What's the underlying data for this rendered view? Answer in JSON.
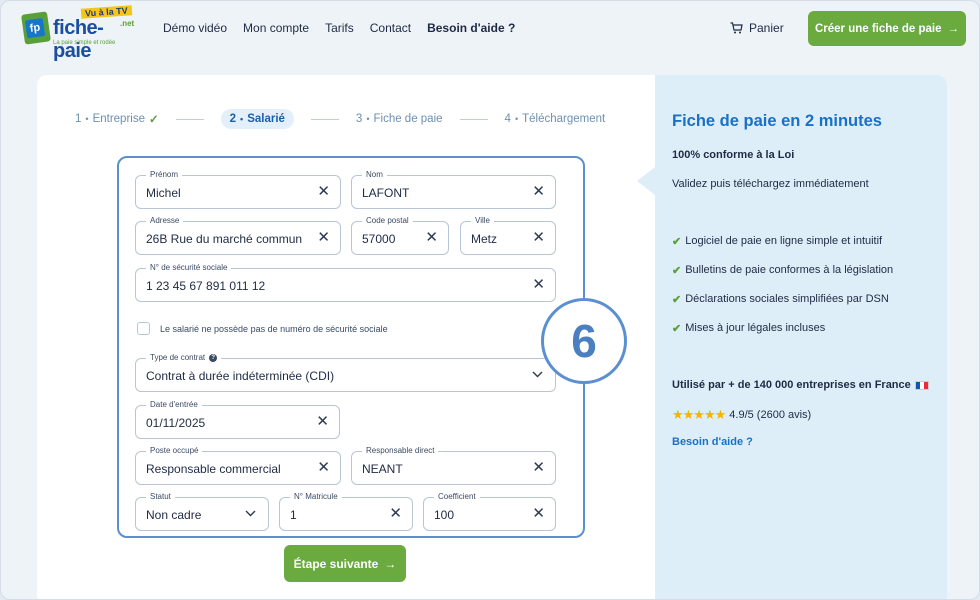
{
  "header": {
    "logo": {
      "name": "fiche-paie",
      "tv_badge": "Vu à la TV",
      "net": ".net",
      "tagline": "La paie simple et rodée"
    },
    "nav": [
      "Démo vidéo",
      "Mon compte",
      "Tarifs",
      "Contact",
      "Besoin d'aide ?"
    ],
    "cart_label": "Panier",
    "cta_label": "Créer une fiche de paie",
    "colors": {
      "accent_green": "#6aaa3e",
      "brand_blue": "#1a70c4"
    }
  },
  "steps": [
    {
      "num": "1",
      "label": "Entreprise",
      "status": "done"
    },
    {
      "num": "2",
      "label": "Salarié",
      "status": "active"
    },
    {
      "num": "3",
      "label": "Fiche de paie",
      "status": "todo"
    },
    {
      "num": "4",
      "label": "Téléchargement",
      "status": "todo"
    }
  ],
  "form": {
    "prenom": {
      "label": "Prénom",
      "value": "Michel"
    },
    "nom": {
      "label": "Nom",
      "value": "LAFONT"
    },
    "adresse": {
      "label": "Adresse",
      "value": "26B Rue du marché commun"
    },
    "code_postal": {
      "label": "Code postal",
      "value": "57000"
    },
    "ville": {
      "label": "Ville",
      "value": "Metz"
    },
    "secu": {
      "label": "N° de sécurité sociale",
      "value": "1 23 45 67 891 011 12"
    },
    "no_secu_checkbox": "Le salarié ne possède pas de numéro de sécurité sociale",
    "contrat": {
      "label": "Type de contrat",
      "value": "Contrat à durée indéterminée (CDI)"
    },
    "date_entree": {
      "label": "Date d'entrée",
      "value": "01/11/2025"
    },
    "poste": {
      "label": "Poste occupé",
      "value": "Responsable commercial"
    },
    "responsable": {
      "label": "Responsable direct",
      "value": "NEANT"
    },
    "statut": {
      "label": "Statut",
      "value": "Non cadre"
    },
    "matricule": {
      "label": "N° Matricule",
      "value": "1"
    },
    "coefficient": {
      "label": "Coefficient",
      "value": "100"
    }
  },
  "badge_number": "6",
  "next_button": "Étape suivante",
  "sidebar": {
    "title": "Fiche de paie en 2 minutes",
    "subtitle": "100% conforme à la Loi",
    "text": "Validez puis téléchargez immédiatement",
    "features": [
      "Logiciel de paie en ligne simple et intuitif",
      "Bulletins de paie conformes à la législation",
      "Déclarations sociales simplifiées par DSN",
      "Mises à jour légales incluses"
    ],
    "used_by": "Utilisé par + de 140 000 entreprises en France",
    "rating": "4.9/5 (2600 avis)",
    "help": "Besoin d'aide ?"
  }
}
